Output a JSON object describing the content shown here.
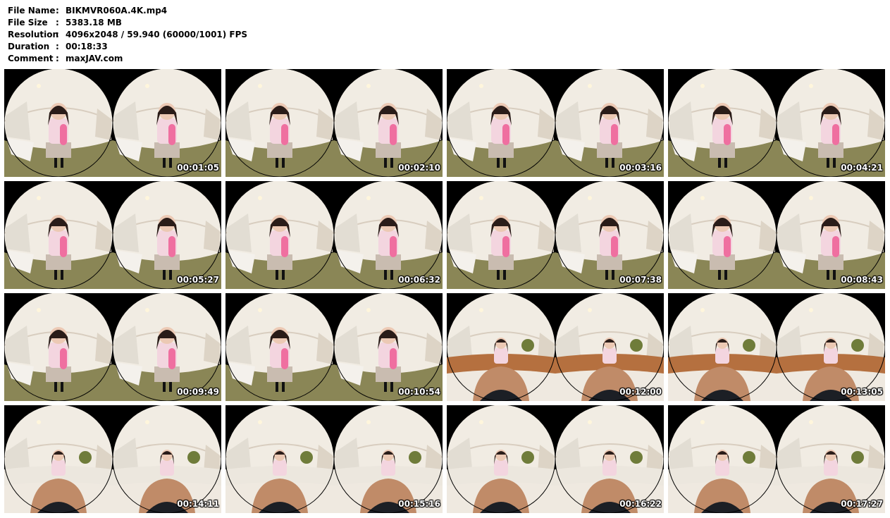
{
  "file_info": [
    {
      "key": "File Name",
      "sep": ":",
      "value": "BIKMVR060A.4K.mp4"
    },
    {
      "key": "File Size",
      "sep": ":",
      "value": "5383.18 MB"
    },
    {
      "key": "Resolution",
      "sep": ":",
      "value": "4096x2048 / 59.940 (60000/1001) FPS"
    },
    {
      "key": "Duration",
      "sep": ":",
      "value": "00:18:33"
    },
    {
      "key": "Comment",
      "sep": ":",
      "value": "maxJAV.com"
    }
  ],
  "thumbnails": [
    {
      "timestamp": "00:01:05",
      "scene": "standing"
    },
    {
      "timestamp": "00:02:10",
      "scene": "standing"
    },
    {
      "timestamp": "00:03:16",
      "scene": "standing"
    },
    {
      "timestamp": "00:04:21",
      "scene": "standing"
    },
    {
      "timestamp": "00:05:27",
      "scene": "standing"
    },
    {
      "timestamp": "00:06:32",
      "scene": "standing"
    },
    {
      "timestamp": "00:07:38",
      "scene": "standing"
    },
    {
      "timestamp": "00:08:43",
      "scene": "standing"
    },
    {
      "timestamp": "00:09:49",
      "scene": "standing"
    },
    {
      "timestamp": "00:10:54",
      "scene": "standing"
    },
    {
      "timestamp": "00:12:00",
      "scene": "sofa"
    },
    {
      "timestamp": "00:13:05",
      "scene": "sofa"
    },
    {
      "timestamp": "00:14:11",
      "scene": "bed"
    },
    {
      "timestamp": "00:15:16",
      "scene": "bed"
    },
    {
      "timestamp": "00:16:22",
      "scene": "bed"
    },
    {
      "timestamp": "00:17:27",
      "scene": "bed"
    }
  ],
  "colors": {
    "page_background": "#ffffff",
    "tile_background": "#000000",
    "timestamp_text": "#ffffff"
  }
}
